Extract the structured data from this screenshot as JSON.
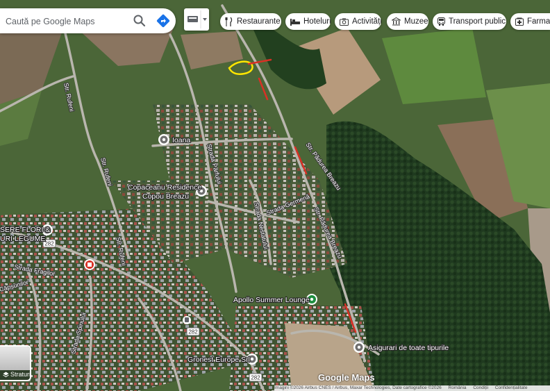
{
  "search": {
    "placeholder": "Caută pe Google Maps"
  },
  "chips": [
    {
      "label": "Restaurante",
      "icon": "fork-knife-icon"
    },
    {
      "label": "Hoteluri",
      "icon": "bed-icon"
    },
    {
      "label": "Activități",
      "icon": "camera-icon"
    },
    {
      "label": "Muzee",
      "icon": "museum-icon"
    },
    {
      "label": "Transport public",
      "icon": "bus-icon"
    },
    {
      "label": "Farmacii",
      "icon": "pharmacy-icon"
    }
  ],
  "places": {
    "ioana": "Ioana",
    "copaceanu_1": "Copaceanu Residence",
    "copaceanu_2": "Copou Breazu",
    "sere_1": "SERE FLORI &",
    "sere_2": "URI LEGUME",
    "apollo": "Apollo Summer Lounge",
    "asigurari": "Asigurari de toate tipurile",
    "gronest": "Gronest Europe Srl"
  },
  "streets": {
    "rufeni_a": "Str. Rufeni",
    "rufeni_b": "Str. Rufeni",
    "rufeni_c": "Str. Rufeni",
    "padurea_breazu_a": "Str. Pădurea Breazu",
    "padurea_breazu_b": "Str. Pădurea Breazu",
    "germena": "Strada Germenă",
    "nestatului": "Strada Nestatului",
    "parfului": "Strada Parfului",
    "fragilor": "Strada Fragilor",
    "capsunilor": "Căpșunilor",
    "spinului": "Strada Spinului"
  },
  "road_badges": [
    "282",
    "282",
    "282"
  ],
  "straturi_label": "Straturi",
  "brand": "Google Maps",
  "footer": {
    "imagery": "Imagini ©2026 Airbus CNES / Airbus, Maxar Technologies, Date cartografice ©2026",
    "country": "România",
    "terms": "Condiții",
    "privacy": "Confidențialitate"
  },
  "colors": {
    "route_red": "#d93025",
    "highlight_yellow": "#ffe600",
    "pin_gray": "#6f6f6f",
    "pin_green": "#1e8e3e",
    "pin_red": "#d93025"
  }
}
